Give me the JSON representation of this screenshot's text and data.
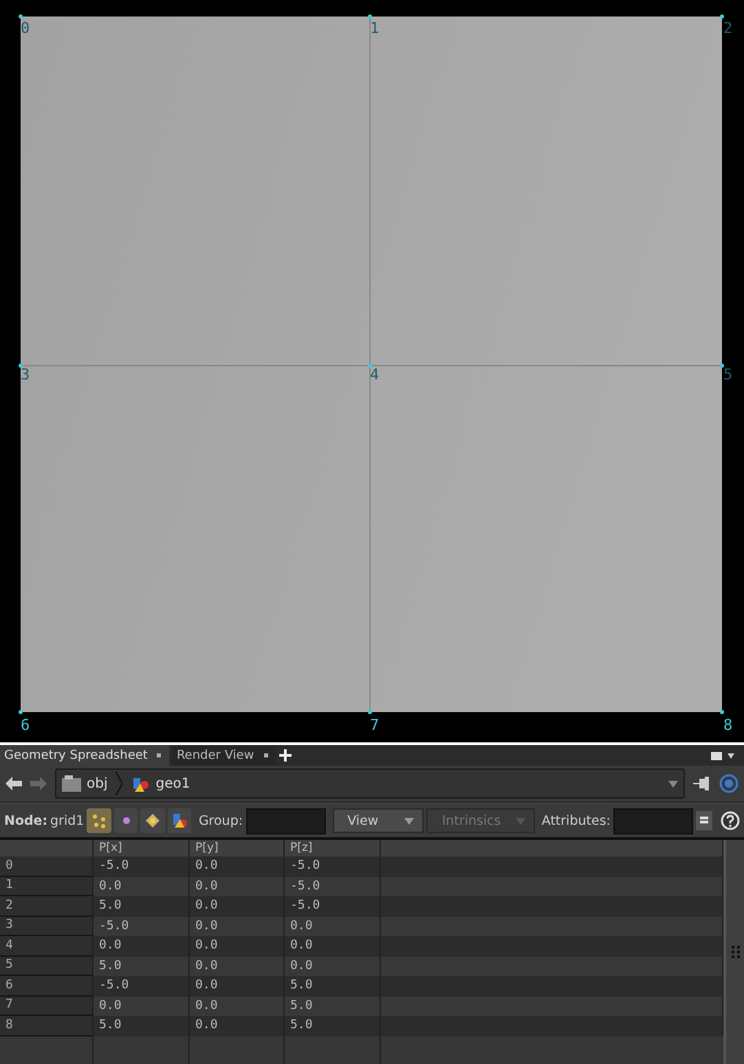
{
  "viewport": {
    "points": [
      {
        "label": "0"
      },
      {
        "label": "1"
      },
      {
        "label": "2"
      },
      {
        "label": "3"
      },
      {
        "label": "4"
      },
      {
        "label": "5"
      },
      {
        "label": "6"
      },
      {
        "label": "7"
      },
      {
        "label": "8"
      }
    ]
  },
  "tabs": [
    {
      "label": "Geometry Spreadsheet",
      "selected": true
    },
    {
      "label": "Render View",
      "selected": false
    }
  ],
  "path": [
    "obj",
    "geo1"
  ],
  "toolbar": {
    "node_label": "Node:",
    "node": "grid1",
    "modes": [
      {
        "kind": "points",
        "selected": true
      },
      {
        "kind": "vertices",
        "selected": false
      },
      {
        "kind": "primitives",
        "selected": false
      },
      {
        "kind": "detail",
        "selected": false
      }
    ],
    "group_label": "Group:",
    "view": "View",
    "intrinsics": {
      "label": "Intrinsics",
      "disabled": true
    },
    "attributes_label": "Attributes:"
  },
  "table": {
    "columns": [
      "P[x]",
      "P[y]",
      "P[z]"
    ],
    "rows": [
      {
        "index": "0",
        "cells": [
          "-5.0",
          "0.0",
          "-5.0"
        ]
      },
      {
        "index": "1",
        "cells": [
          "0.0",
          "0.0",
          "-5.0"
        ]
      },
      {
        "index": "2",
        "cells": [
          "5.0",
          "0.0",
          "-5.0"
        ]
      },
      {
        "index": "3",
        "cells": [
          "-5.0",
          "0.0",
          "0.0"
        ]
      },
      {
        "index": "4",
        "cells": [
          "0.0",
          "0.0",
          "0.0"
        ]
      },
      {
        "index": "5",
        "cells": [
          "5.0",
          "0.0",
          "0.0"
        ]
      },
      {
        "index": "6",
        "cells": [
          "-5.0",
          "0.0",
          "5.0"
        ]
      },
      {
        "index": "7",
        "cells": [
          "0.0",
          "0.0",
          "5.0"
        ]
      },
      {
        "index": "8",
        "cells": [
          "5.0",
          "0.0",
          "5.0"
        ]
      }
    ]
  }
}
